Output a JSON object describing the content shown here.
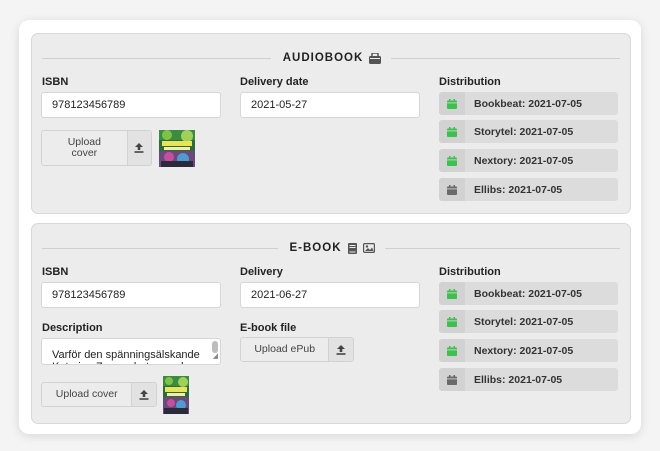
{
  "audiobook": {
    "title": "AUDIOBOOK",
    "isbn_label": "ISBN",
    "isbn_value": "978123456789",
    "delivery_label": "Delivery date",
    "delivery_value": "2021-05-27",
    "upload_label": "Upload cover",
    "distribution_label": "Distribution",
    "distribution": [
      {
        "label": "Bookbeat: 2021-07-05",
        "status_color": "#3fbf4f"
      },
      {
        "label": "Storytel: 2021-07-05",
        "status_color": "#3fbf4f"
      },
      {
        "label": "Nextory: 2021-07-05",
        "status_color": "#3fbf4f"
      },
      {
        "label": "Ellibs: 2021-07-05",
        "status_color": "#6a6a6a"
      }
    ]
  },
  "ebook": {
    "title": "E-BOOK",
    "isbn_label": "ISBN",
    "isbn_value": "978123456789",
    "delivery_label": "Delivery",
    "delivery_value": "2021-06-27",
    "description_label": "Description",
    "description_value": "Varför den spänningsälskande Katarina Zapp arbetar med",
    "file_label": "E-book file",
    "upload_epub_label": "Upload ePub",
    "upload_cover_label": "Upload cover",
    "distribution_label": "Distribution",
    "distribution": [
      {
        "label": "Bookbeat: 2021-07-05",
        "status_color": "#3fbf4f"
      },
      {
        "label": "Storytel: 2021-07-05",
        "status_color": "#3fbf4f"
      },
      {
        "label": "Nextory: 2021-07-05",
        "status_color": "#3fbf4f"
      },
      {
        "label": "Ellibs: 2021-07-05",
        "status_color": "#6a6a6a"
      }
    ]
  }
}
